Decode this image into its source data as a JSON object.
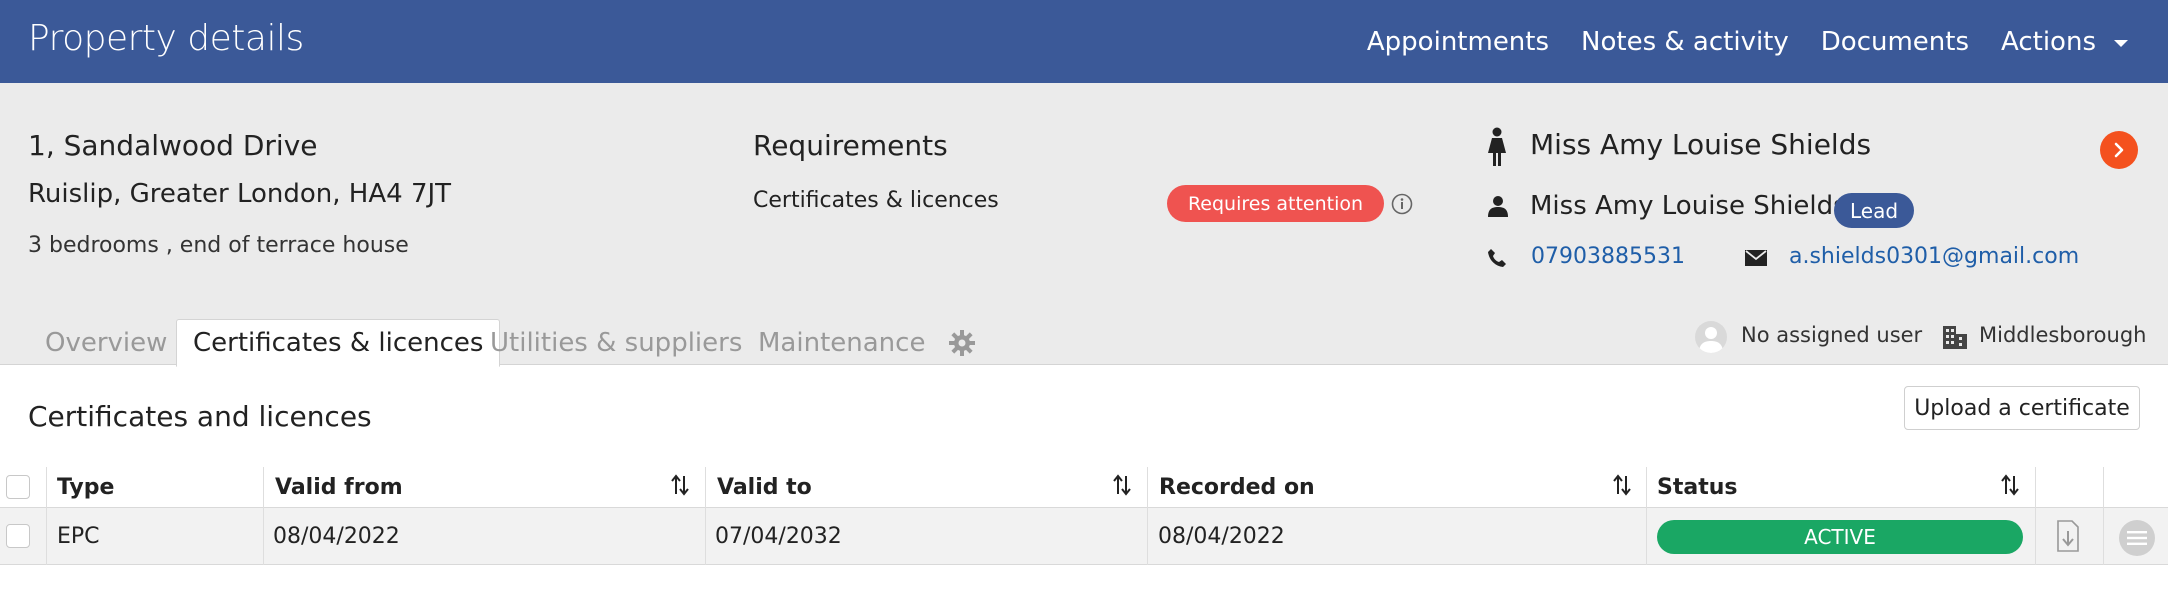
{
  "header": {
    "title": "Property details",
    "nav": [
      "Appointments",
      "Notes & activity",
      "Documents"
    ],
    "actions_label": "Actions"
  },
  "property": {
    "address_line1": "1, Sandalwood Drive",
    "address_line2": "Ruislip, Greater London, HA4 7JT",
    "description": "3 bedrooms , end of terrace house"
  },
  "requirements": {
    "title": "Requirements",
    "item_label": "Certificates & licences",
    "item_status": "Requires attention"
  },
  "owner": {
    "name": "Miss Amy Louise Shields",
    "contact_name": "Miss Amy Louise Shields",
    "contact_badge": "Lead",
    "phone": "07903885531",
    "email": "a.shields0301@gmail.com"
  },
  "tabs": [
    {
      "label": "Overview",
      "active": false
    },
    {
      "label": "Certificates & licences",
      "active": true
    },
    {
      "label": "Utilities & suppliers",
      "active": false
    },
    {
      "label": "Maintenance",
      "active": false
    }
  ],
  "assignment": {
    "user_label": "No assigned user",
    "office_label": "Middlesborough"
  },
  "main": {
    "section_title": "Certificates and licences",
    "upload_label": "Upload a certificate"
  },
  "table": {
    "columns": [
      "Type",
      "Valid from",
      "Valid to",
      "Recorded on",
      "Status"
    ],
    "rows": [
      {
        "type": "EPC",
        "valid_from": "08/04/2022",
        "valid_to": "07/04/2032",
        "recorded_on": "08/04/2022",
        "status": "ACTIVE"
      }
    ]
  },
  "colors": {
    "header_bg": "#3b5998",
    "attention": "#ef5350",
    "active_status": "#1aa764",
    "go_button": "#f4511e",
    "link": "#1f5ea8"
  },
  "icons": [
    "chevron-down-icon",
    "info-icon",
    "female-person-icon",
    "arrow-right-icon",
    "user-icon",
    "phone-icon",
    "mail-icon",
    "gear-icon",
    "avatar-icon",
    "building-icon",
    "sort-icon",
    "download-icon",
    "menu-icon"
  ]
}
